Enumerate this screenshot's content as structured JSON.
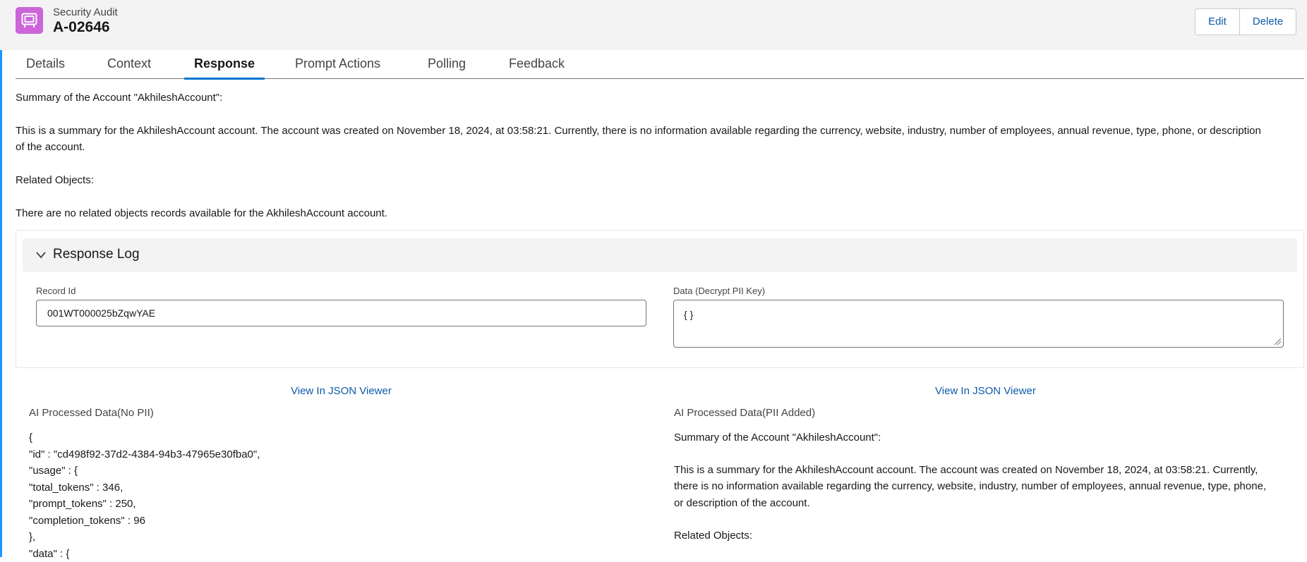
{
  "header": {
    "object_type": "Security Audit",
    "record_name": "A-02646",
    "icon": "security-audit-icon",
    "icon_color": "#cb65d9",
    "actions": {
      "edit_label": "Edit",
      "delete_label": "Delete"
    }
  },
  "tabs": [
    {
      "label": "Details"
    },
    {
      "label": "Context"
    },
    {
      "label": "Response",
      "active": true
    },
    {
      "label": "Prompt Actions"
    },
    {
      "label": "Polling"
    },
    {
      "label": "Feedback"
    }
  ],
  "response": {
    "summary_heading": "Summary of the Account \"AkhileshAccount\":",
    "summary_body_line1": "This is a summary for the AkhileshAccount account. The account was created on November 18, 2024, at 03:58:21. Currently, there is no information available regarding the currency, website, industry, number of employees, annual revenue, type, phone, or description",
    "summary_body_line2": "of the account.",
    "related_heading": "Related Objects:",
    "related_body": "There are no related objects records available for the AkhileshAccount account."
  },
  "response_log": {
    "title": "Response Log",
    "expanded": true,
    "record_id": {
      "label": "Record Id",
      "value": "001WT000025bZqwYAE"
    },
    "decrypt_data": {
      "label": "Data (Decrypt PII Key)",
      "value": "{ }"
    }
  },
  "processed": {
    "left": {
      "viewer_link": "View In JSON Viewer",
      "label": "AI Processed Data(No PII)",
      "lines": [
        "{",
        "\"id\" : \"cd498f92-37d2-4384-94b3-47965e30fba0\",",
        "\"usage\" : {",
        "\"total_tokens\" : 346,",
        "\"prompt_tokens\" : 250,",
        "\"completion_tokens\" : 96",
        "},",
        "\"data\" : {"
      ]
    },
    "right": {
      "viewer_link": "View In JSON Viewer",
      "label": "AI Processed Data(PII Added)",
      "summary_heading": "Summary of the Account \"AkhileshAccount\":",
      "body_lines": [
        "This is a summary for the AkhileshAccount account. The account was created on November 18, 2024, at 03:58:21. Currently,",
        "there is no information available regarding the currency, website, industry, number of employees, annual revenue, type, phone,",
        "or description of the account."
      ],
      "related_heading": "Related Objects:"
    }
  },
  "colors": {
    "brand": "#0176d3",
    "link": "#0b5cab",
    "header_bg": "#f3f3f3",
    "left_accent": "#1b96ff"
  }
}
